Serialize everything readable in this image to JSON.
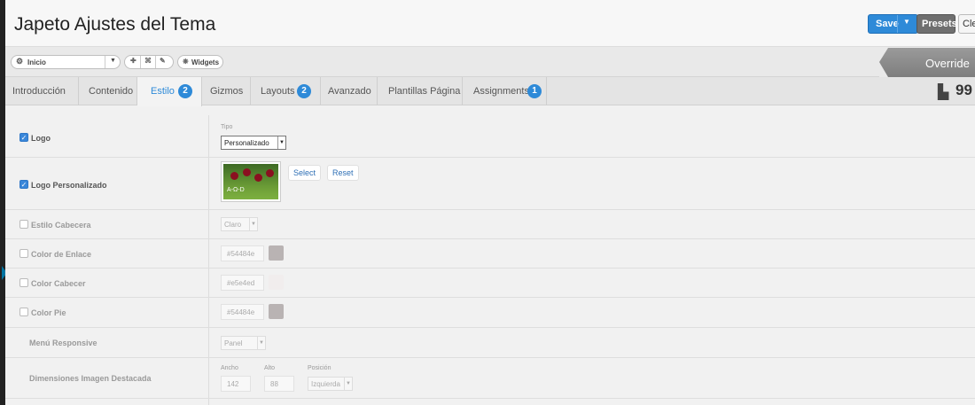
{
  "header": {
    "title": "Japeto Ajustes del Tema",
    "save_label": "Save",
    "presets_label": "Presets",
    "clear_label": "Clear"
  },
  "toolbar": {
    "outline_select": "Inicio",
    "widgets_label": "Widgets",
    "override_label": "Override"
  },
  "tabs": [
    {
      "label": "Introducción"
    },
    {
      "label": "Contenido"
    },
    {
      "label": "Estilo",
      "badge": "2",
      "active": true
    },
    {
      "label": "Gizmos"
    },
    {
      "label": "Layouts",
      "badge": "2"
    },
    {
      "label": "Avanzado"
    },
    {
      "label": "Plantillas Página"
    },
    {
      "label": "Assignments",
      "badge": "1"
    }
  ],
  "brand": {
    "logo_text": "99"
  },
  "settings": {
    "logo": {
      "label": "Logo",
      "checked": true,
      "tipo_caption": "Tipo",
      "tipo_value": "Personalizado"
    },
    "logo_custom": {
      "label": "Logo Personalizado",
      "checked": true,
      "select_label": "Select",
      "reset_label": "Reset",
      "thumb_text": "A-Ω-D"
    },
    "header_style": {
      "label": "Estilo Cabecera",
      "checked": false,
      "value": "Claro"
    },
    "link_color": {
      "label": "Color de Enlace",
      "checked": false,
      "value": "#54484e"
    },
    "header_color": {
      "label": "Color Cabecer",
      "checked": false,
      "value": "#e5e4ed"
    },
    "footer_color": {
      "label": "Color Pie",
      "checked": false,
      "value": "#54484e"
    },
    "responsive_menu": {
      "label": "Menú Responsive",
      "value": "Panel"
    },
    "featured_image": {
      "label": "Dimensiones Imagen Destacada",
      "width_caption": "Ancho",
      "width_value": "142",
      "height_caption": "Alto",
      "height_value": "88",
      "position_caption": "Posición",
      "position_value": "Izquierda"
    }
  },
  "colors": {
    "accent": "#2e8ad8",
    "override": "#8a8a8a"
  }
}
